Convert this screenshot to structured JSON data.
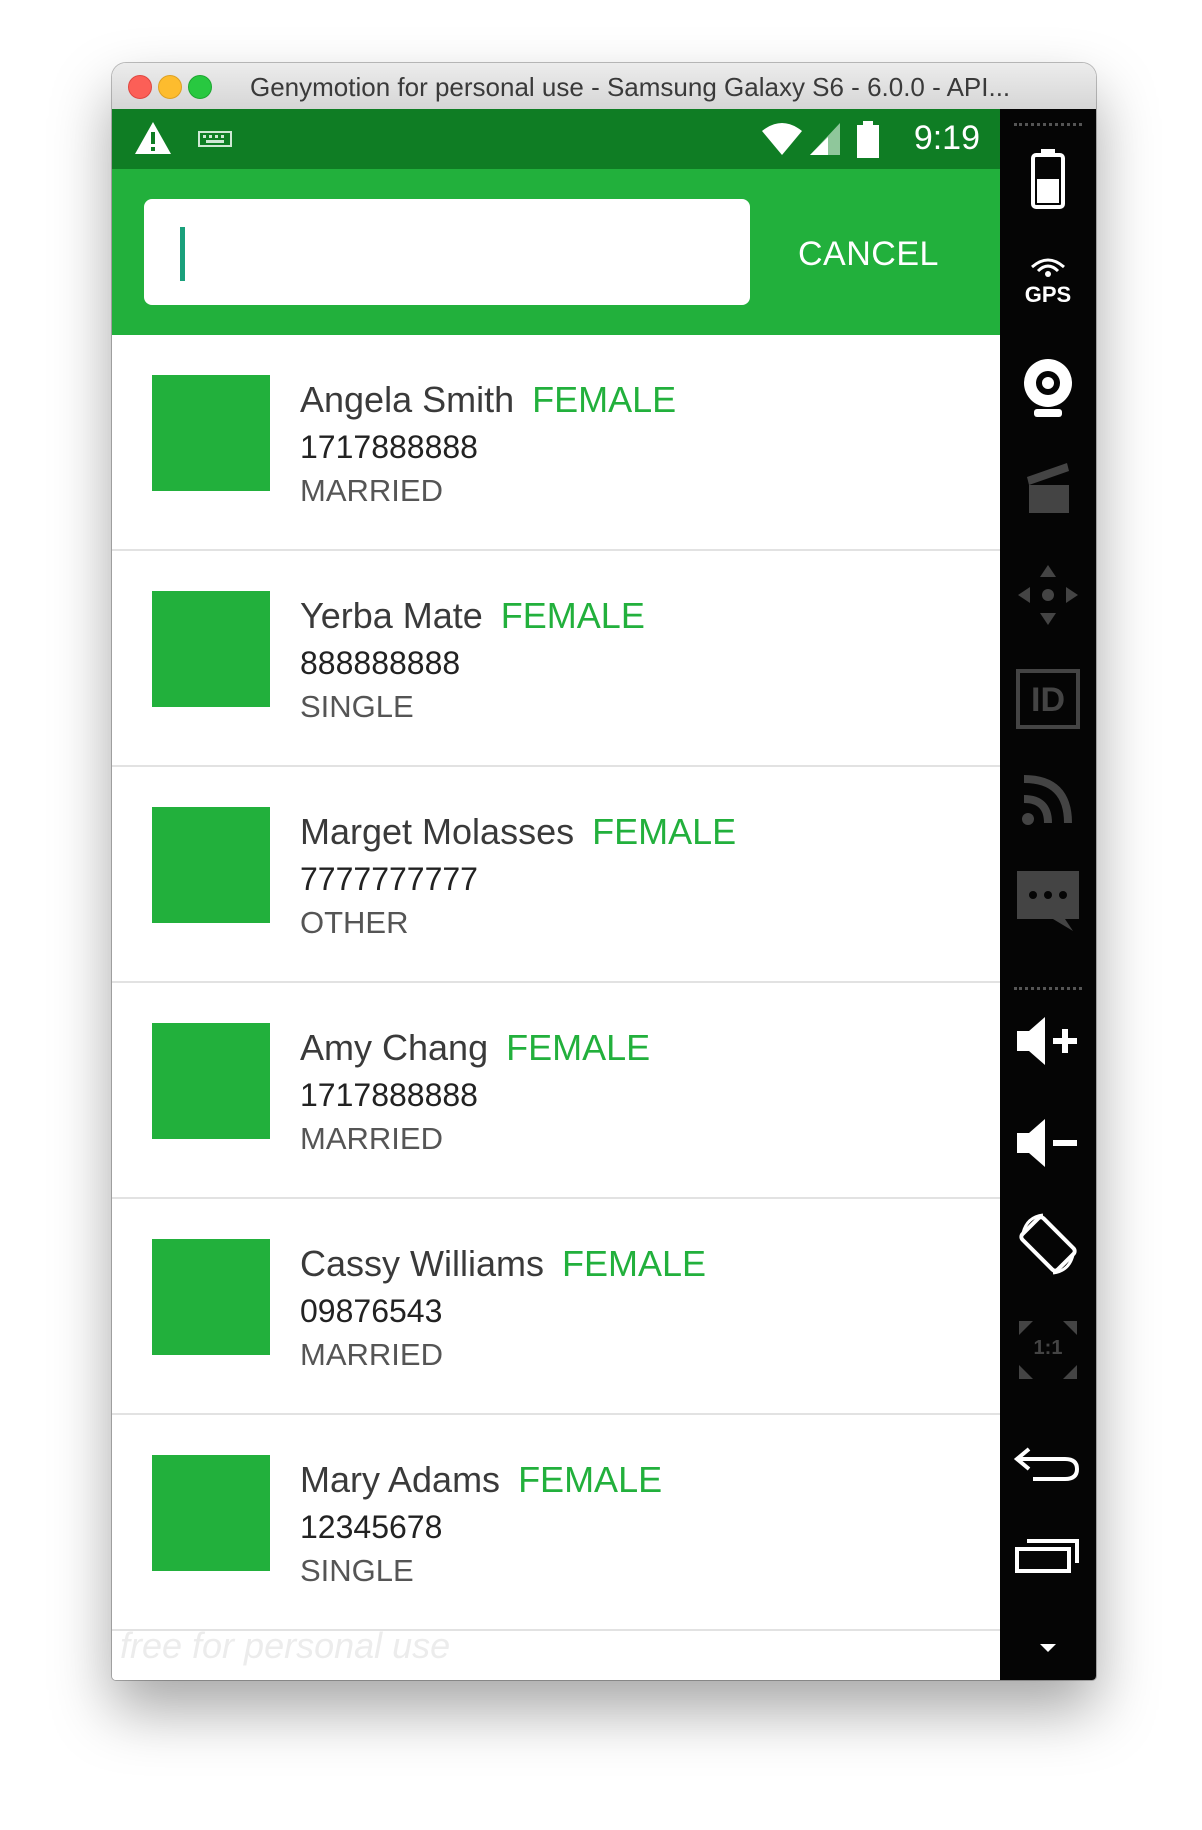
{
  "window": {
    "title": "Genymotion for personal use - Samsung Galaxy S6 - 6.0.0 - API..."
  },
  "status_bar": {
    "time": "9:19"
  },
  "search": {
    "value": "",
    "placeholder": ""
  },
  "toolbar": {
    "cancel_label": "CANCEL"
  },
  "contacts": [
    {
      "name": "Angela Smith",
      "gender": "FEMALE",
      "phone": "1717888888",
      "status": "MARRIED"
    },
    {
      "name": "Yerba Mate",
      "gender": "FEMALE",
      "phone": "888888888",
      "status": "SINGLE"
    },
    {
      "name": "Marget Molasses",
      "gender": "FEMALE",
      "phone": "7777777777",
      "status": "OTHER"
    },
    {
      "name": "Amy Chang",
      "gender": "FEMALE",
      "phone": "1717888888",
      "status": "MARRIED"
    },
    {
      "name": "Cassy Williams",
      "gender": "FEMALE",
      "phone": "09876543",
      "status": "MARRIED"
    },
    {
      "name": "Mary Adams",
      "gender": "FEMALE",
      "phone": "12345678",
      "status": "SINGLE"
    }
  ],
  "watermark": "free for personal use",
  "sidebar": {
    "gps_label": "GPS",
    "id_label": "ID",
    "scale_label": "1:1"
  },
  "colors": {
    "accent": "#22b03c",
    "status_bar": "#0f7d24",
    "sidebar": "#050505"
  }
}
